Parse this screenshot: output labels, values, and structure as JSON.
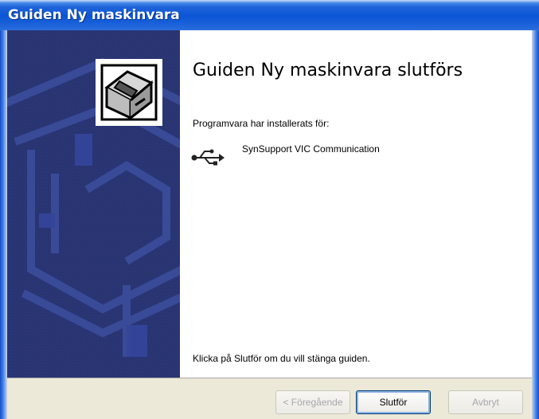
{
  "window": {
    "title": "Guiden Ny maskinvara"
  },
  "content": {
    "heading": "Guiden Ny maskinvara slutförs",
    "intro": "Programvara har installerats för:",
    "device": {
      "name": "SynSupport VIC Communication",
      "icon": "usb-icon"
    },
    "footer": "Klicka på Slutför om du vill stänga guiden."
  },
  "buttons": {
    "back": "< Föregående",
    "finish": "Slutför",
    "cancel": "Avbryt"
  },
  "colors": {
    "title_bar": "#0a56d6",
    "side_panel": "#27326e",
    "button_bar": "#ece9d8"
  }
}
